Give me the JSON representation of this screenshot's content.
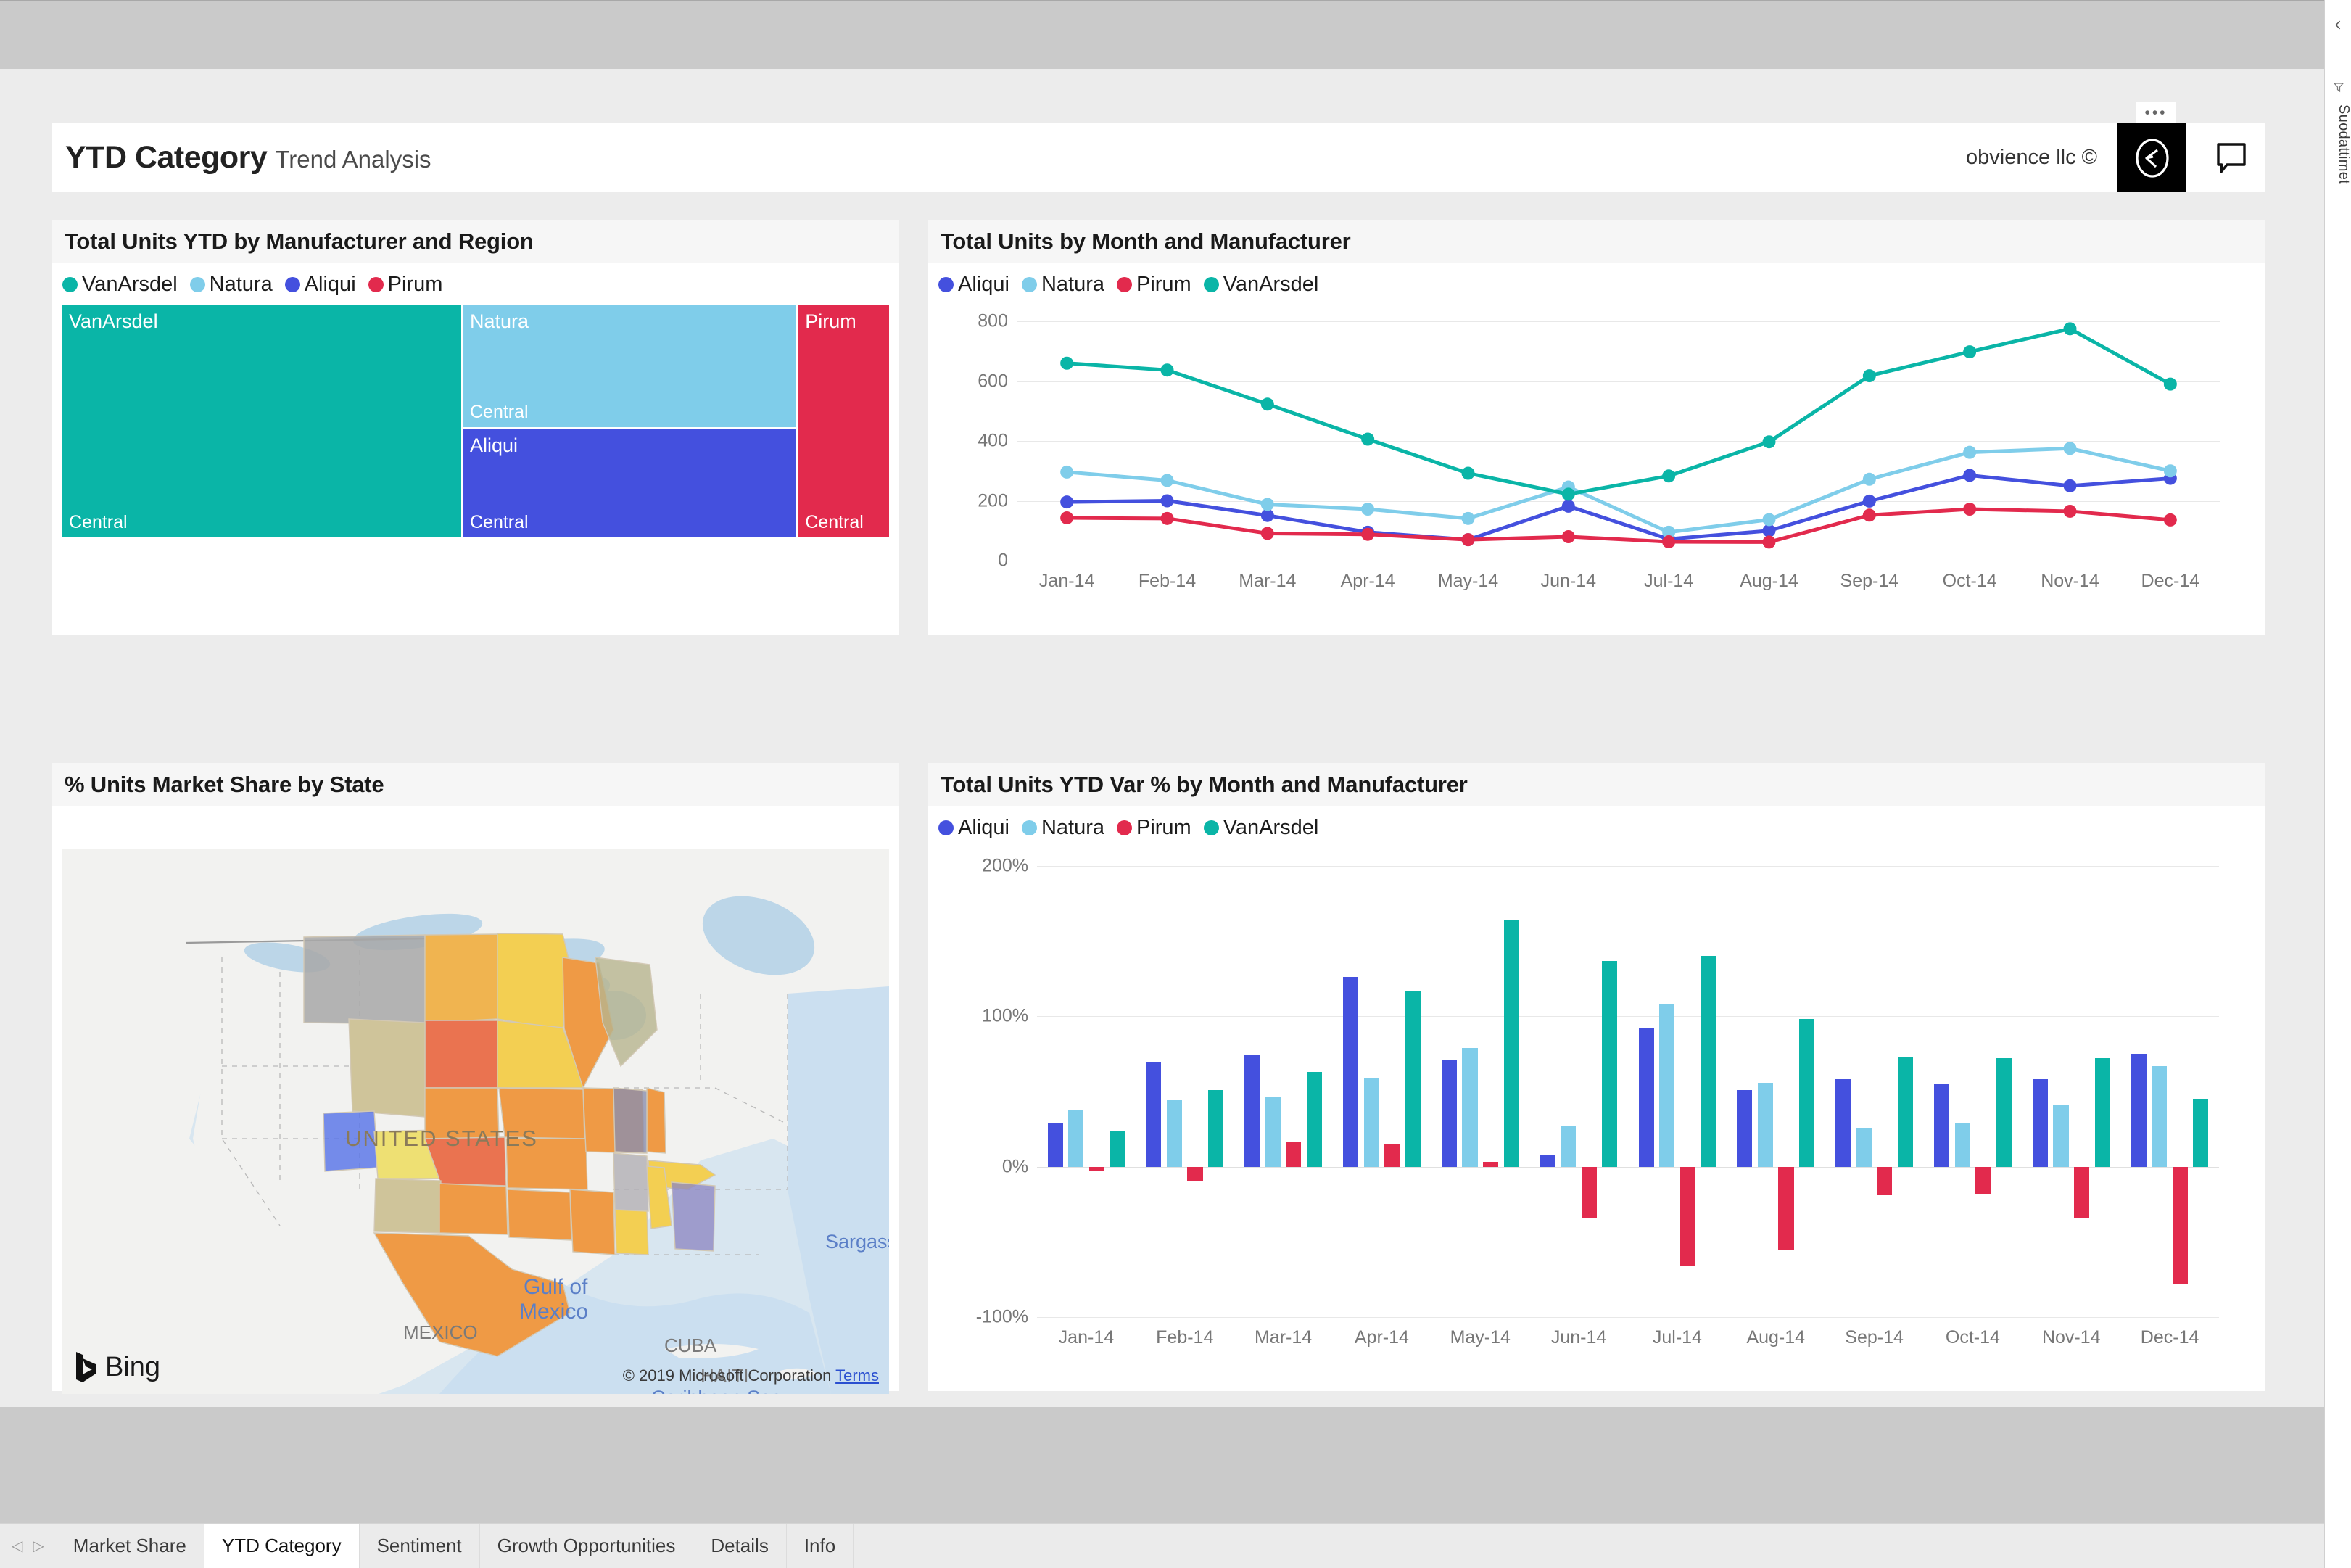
{
  "window": {
    "filters_label": "Suodattimet",
    "collapse_icon": "chevron-left-icon",
    "funnel_icon": "filter-funnel-icon"
  },
  "header": {
    "title": "YTD Category",
    "subtitle": "Trend Analysis",
    "brand": "obvience llc ©",
    "logo_icon": "circle-arrow-logo-icon",
    "comment_icon": "comment-bubble-icon",
    "ellipsis": "•••"
  },
  "colors": {
    "VanArsdel": "#0ab5a7",
    "Natura": "#7fcdea",
    "Aliqui": "#4450de",
    "Pirum": "#e22a4d",
    "grid": "#e8e8e8",
    "axis_text": "#777777",
    "card_bg": "#ffffff",
    "title_bg": "#f6f6f6",
    "canvas_bg": "#ececec",
    "chrome": "#cacaca"
  },
  "visuals": {
    "treemap": {
      "title": "Total Units YTD by Manufacturer and Region",
      "legend": [
        "VanArsdel",
        "Natura",
        "Aliqui",
        "Pirum"
      ]
    },
    "line": {
      "title": "Total Units by Month and Manufacturer",
      "legend": [
        "Aliqui",
        "Natura",
        "Pirum",
        "VanArsdel"
      ]
    },
    "map": {
      "title": "% Units Market Share by State",
      "bing_label": "Bing",
      "credit": "© 2019 Microsoft Corporation",
      "terms": "Terms",
      "labels": [
        "UNITED STATES",
        "MEXICO",
        "CUBA",
        "HAITI",
        "Gulf of",
        "Mexico",
        "Sargasso",
        "Caribbean Sea"
      ]
    },
    "bar": {
      "title": "Total Units YTD Var % by Month and Manufacturer",
      "legend": [
        "Aliqui",
        "Natura",
        "Pirum",
        "VanArsdel"
      ]
    }
  },
  "tabs": {
    "prev_icon": "chevron-left-small-icon",
    "next_icon": "chevron-right-small-icon",
    "items": [
      {
        "label": "Market Share",
        "active": false
      },
      {
        "label": "YTD Category",
        "active": true
      },
      {
        "label": "Sentiment",
        "active": false
      },
      {
        "label": "Growth Opportunities",
        "active": false
      },
      {
        "label": "Details",
        "active": false
      },
      {
        "label": "Info",
        "active": false
      }
    ]
  },
  "chart_data": [
    {
      "id": "treemap",
      "type": "treemap",
      "title": "Total Units YTD by Manufacturer and Region",
      "legend": [
        "VanArsdel",
        "Natura",
        "Aliqui",
        "Pirum"
      ],
      "legend_position": "top",
      "nodes": [
        {
          "group": "VanArsdel",
          "region": "Central",
          "share": 0.485,
          "color": "#0ab5a7"
        },
        {
          "group": "Natura",
          "region": "Central",
          "share": 0.215,
          "color": "#7fcdea"
        },
        {
          "group": "Aliqui",
          "region": "Central",
          "share": 0.19,
          "color": "#4450de"
        },
        {
          "group": "Pirum",
          "region": "Central",
          "share": 0.11,
          "color": "#e22a4d"
        }
      ]
    },
    {
      "id": "line",
      "type": "line",
      "title": "Total Units by Month and Manufacturer",
      "xlabel": "",
      "ylabel": "",
      "ylim": [
        0,
        800
      ],
      "yticks": [
        0,
        200,
        400,
        600,
        800
      ],
      "grid": true,
      "legend_position": "top",
      "categories": [
        "Jan-14",
        "Feb-14",
        "Mar-14",
        "Apr-14",
        "May-14",
        "Jun-14",
        "Jul-14",
        "Aug-14",
        "Sep-14",
        "Oct-14",
        "Nov-14",
        "Dec-14"
      ],
      "series": [
        {
          "name": "Aliqui",
          "color": "#4450de",
          "values": [
            196,
            200,
            151,
            95,
            70,
            182,
            72,
            100,
            199,
            285,
            250,
            275
          ]
        },
        {
          "name": "Natura",
          "color": "#7fcdea",
          "values": [
            296,
            268,
            188,
            172,
            141,
            246,
            95,
            137,
            272,
            362,
            375,
            300
          ]
        },
        {
          "name": "Pirum",
          "color": "#e22a4d",
          "values": [
            143,
            141,
            91,
            88,
            70,
            80,
            63,
            62,
            152,
            172,
            165,
            136
          ]
        },
        {
          "name": "VanArsdel",
          "color": "#0ab5a7",
          "values": [
            660,
            637,
            523,
            406,
            292,
            222,
            283,
            397,
            618,
            698,
            775,
            590
          ]
        }
      ]
    },
    {
      "id": "map",
      "type": "choropleth",
      "title": "% Units Market Share by State",
      "basemap": "Bing",
      "region": "United States",
      "note": "State polygons shaded by % units market share"
    },
    {
      "id": "bar",
      "type": "bar",
      "title": "Total Units YTD Var % by Month and Manufacturer",
      "xlabel": "",
      "ylabel": "",
      "ylim": [
        -100,
        200
      ],
      "yticks": [
        -100,
        0,
        100,
        200
      ],
      "ytick_labels": [
        "-100%",
        "0%",
        "100%",
        "200%"
      ],
      "grid": true,
      "legend_position": "top",
      "categories": [
        "Jan-14",
        "Feb-14",
        "Mar-14",
        "Apr-14",
        "May-14",
        "Jun-14",
        "Jul-14",
        "Aug-14",
        "Sep-14",
        "Oct-14",
        "Nov-14",
        "Dec-14"
      ],
      "series": [
        {
          "name": "Aliqui",
          "color": "#4450de",
          "values": [
            29,
            70,
            74,
            126,
            71,
            8,
            92,
            51,
            58,
            55,
            58,
            75
          ]
        },
        {
          "name": "Natura",
          "color": "#7fcdea",
          "values": [
            38,
            44,
            46,
            59,
            79,
            27,
            108,
            56,
            26,
            29,
            41,
            67
          ]
        },
        {
          "name": "Pirum",
          "color": "#e22a4d",
          "values": [
            -3,
            -10,
            16,
            15,
            3,
            -34,
            -66,
            -55,
            -19,
            -18,
            -34,
            -78
          ]
        },
        {
          "name": "VanArsdel",
          "color": "#0ab5a7",
          "values": [
            24,
            51,
            63,
            117,
            164,
            137,
            140,
            98,
            73,
            72,
            72,
            45
          ]
        }
      ]
    }
  ]
}
